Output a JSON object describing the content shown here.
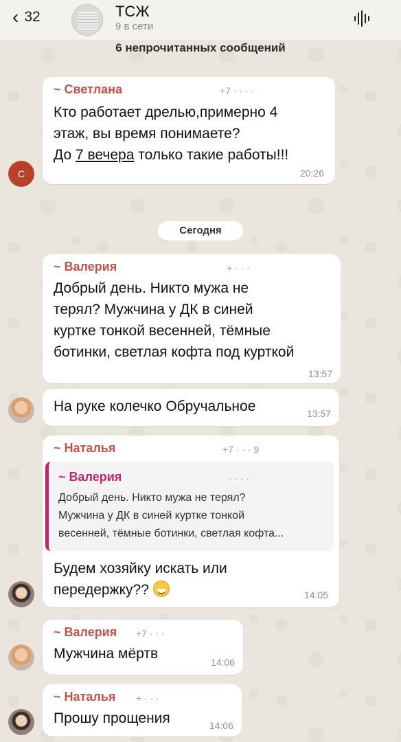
{
  "header": {
    "back_count": "32",
    "group_name": "ТСЖ",
    "status": "9 в сети",
    "unread": "6 непрочитанных сообщений"
  },
  "date_divider": "Сегодня",
  "messages": [
    {
      "sender": "~ Светлана",
      "phone": "+7 ·   ·   ·   ·",
      "lines": [
        "Кто работает дрелью,примерно 4",
        "этаж, вы время понимаете?"
      ],
      "line3_before": "До ",
      "line3_underlined": "7 вечера",
      "line3_after": " только такие работы!!!",
      "time": "20:26",
      "avatar_letter": "С"
    },
    {
      "sender": "~ Валерия",
      "phone": "+ ·   ·   ·",
      "lines": [
        "Добрый день. Никто мужа не",
        "терял? Мужчина у ДК в синей",
        "куртке тонкой весенней, тёмные",
        "ботинки, светлая кофта под курткой"
      ],
      "time": "13:57"
    },
    {
      "text": "На руке колечко Обручальное",
      "time": "13:57"
    },
    {
      "sender": "~ Наталья",
      "phone": "+7 ·   ·   ·   9",
      "quote_sender": "~ Валерия",
      "quote_phone": "· ·   ·   ·",
      "quote_lines": [
        "Добрый день. Никто мужа не терял?",
        "Мужчина у ДК в синей куртке тонкой",
        "весенней, тёмные ботинки, светлая кофта..."
      ],
      "lines": [
        "Будем хозяйку искать или",
        "передержку??"
      ],
      "emoji": "grinning-face",
      "time": "14:05"
    },
    {
      "sender": "~ Валерия",
      "phone": "+7 ·   ·   ·",
      "text": "Мужчина мёртв",
      "time": "14:06"
    },
    {
      "sender": "~ Наталья",
      "phone": "+ ·   ·   ·",
      "text": "Прошу прощения",
      "time": "14:06"
    }
  ],
  "colors": {
    "background": "#ebe6dd",
    "sender_name": "#c4524a",
    "quote_accent": "#c4236c"
  }
}
